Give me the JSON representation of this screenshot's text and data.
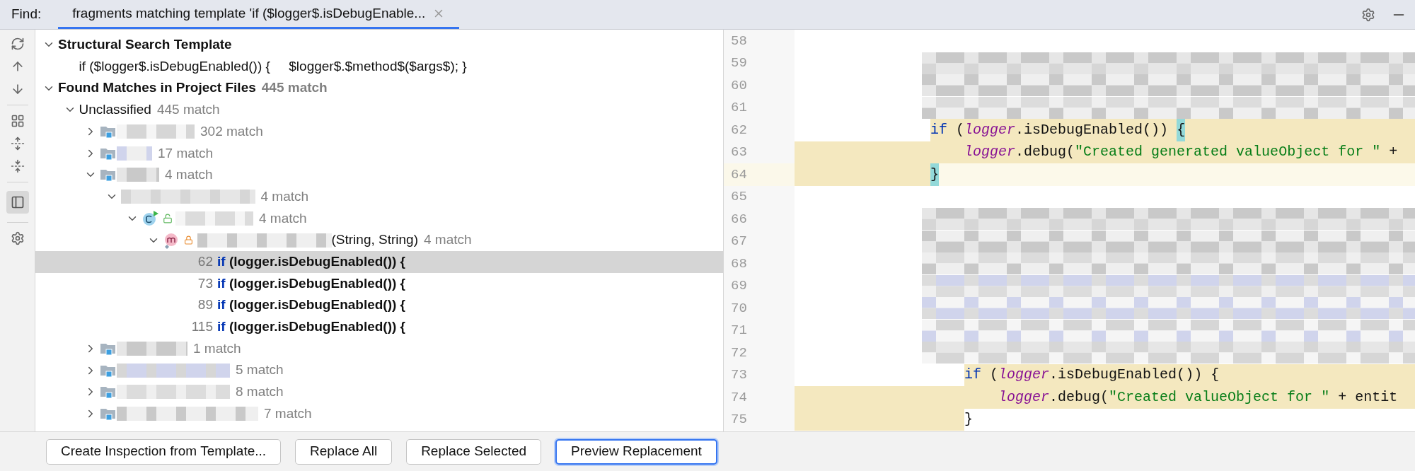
{
  "find_bar": {
    "label": "Find:",
    "tabs": [
      {
        "title": "fragments matching template 'if ($logger$.isDebugEnable...",
        "selected": true
      }
    ]
  },
  "toolbar": {
    "preview_on": true
  },
  "tree": [
    {
      "kind": "section",
      "label": "Structural Search Template",
      "expanded": true,
      "children": [
        {
          "kind": "template",
          "label": "if ($logger$.isDebugEnabled()) {     $logger$.$method$($args$); }"
        }
      ]
    },
    {
      "kind": "section",
      "label": "Found Matches in Project Files",
      "count": "445 match",
      "expanded": true,
      "children": [
        {
          "kind": "group",
          "label": "Unclassified",
          "count": "445 match",
          "expanded": true,
          "children": [
            {
              "kind": "folder",
              "count": "302 match",
              "expanded": false
            },
            {
              "kind": "folder",
              "count": "17 match",
              "expanded": false
            },
            {
              "kind": "folder",
              "count": "4 match",
              "expanded": true,
              "children": [
                {
                  "kind": "package",
                  "count": "4 match",
                  "expanded": true,
                  "children": [
                    {
                      "kind": "class",
                      "count": "4 match",
                      "expanded": true,
                      "children": [
                        {
                          "kind": "method",
                          "label": "(String, String)",
                          "count": "4 match",
                          "expanded": true,
                          "children": [
                            {
                              "kind": "match",
                              "line": "62",
                              "keyword": "if",
                              "code": "(logger.isDebugEnabled()) {",
                              "selected": true
                            },
                            {
                              "kind": "match",
                              "line": "73",
                              "keyword": "if",
                              "code": "(logger.isDebugEnabled()) {",
                              "selected": false
                            },
                            {
                              "kind": "match",
                              "line": "89",
                              "keyword": "if",
                              "code": "(logger.isDebugEnabled()) {",
                              "selected": false
                            },
                            {
                              "kind": "match",
                              "line": "115",
                              "keyword": "if",
                              "code": "(logger.isDebugEnabled()) {",
                              "selected": false
                            }
                          ]
                        }
                      ]
                    }
                  ]
                }
              ]
            },
            {
              "kind": "folder",
              "count": "1 match",
              "expanded": false
            },
            {
              "kind": "folder",
              "count": "5 match",
              "expanded": false
            },
            {
              "kind": "folder",
              "count": "8 match",
              "expanded": false
            },
            {
              "kind": "folder",
              "count": "7 match",
              "expanded": false
            }
          ]
        }
      ]
    }
  ],
  "editor": {
    "lines": [
      {
        "number": "58",
        "kind": "blank",
        "current": false
      },
      {
        "number": "59",
        "kind": "redacted",
        "current": false
      },
      {
        "number": "60",
        "kind": "redacted",
        "current": false
      },
      {
        "number": "61",
        "kind": "redacted",
        "current": false
      },
      {
        "number": "62",
        "kind": "code",
        "highlight_indent": false,
        "highlight_text": true,
        "current": false,
        "tokens": [
          {
            "kind": "keyword",
            "text": "                if"
          },
          {
            "kind": "plain",
            "text": " ("
          },
          {
            "kind": "field",
            "text": "logger"
          },
          {
            "kind": "plain",
            "text": ".isDebugEnabled()) "
          },
          {
            "kind": "brace",
            "text": "{"
          }
        ]
      },
      {
        "number": "63",
        "kind": "code",
        "highlight_indent": true,
        "highlight_text": true,
        "current": false,
        "tokens": [
          {
            "kind": "field",
            "text": "                    logger"
          },
          {
            "kind": "plain",
            "text": ".debug("
          },
          {
            "kind": "string",
            "text": "\"Created generated valueObject for \""
          },
          {
            "kind": "plain",
            "text": " +"
          }
        ]
      },
      {
        "number": "64",
        "kind": "code",
        "highlight_indent": true,
        "highlight_text": false,
        "current": true,
        "tokens": [
          {
            "kind": "brace",
            "text": "                }"
          }
        ]
      },
      {
        "number": "65",
        "kind": "blank",
        "current": false
      },
      {
        "number": "66",
        "kind": "redacted",
        "current": false
      },
      {
        "number": "67",
        "kind": "redacted",
        "current": false
      },
      {
        "number": "68",
        "kind": "redacted",
        "current": false
      },
      {
        "number": "69",
        "kind": "redacted",
        "current": false
      },
      {
        "number": "70",
        "kind": "redacted",
        "current": false
      },
      {
        "number": "71",
        "kind": "redacted",
        "current": false
      },
      {
        "number": "72",
        "kind": "redacted",
        "current": false
      },
      {
        "number": "73",
        "kind": "code",
        "highlight_indent": false,
        "highlight_text": true,
        "current": false,
        "tokens": [
          {
            "kind": "keyword",
            "text": "                    if"
          },
          {
            "kind": "plain",
            "text": " ("
          },
          {
            "kind": "field",
            "text": "logger"
          },
          {
            "kind": "plain",
            "text": ".isDebugEnabled()) {"
          }
        ]
      },
      {
        "number": "74",
        "kind": "code",
        "highlight_indent": true,
        "highlight_text": true,
        "current": false,
        "tokens": [
          {
            "kind": "field",
            "text": "                        logger"
          },
          {
            "kind": "plain",
            "text": ".debug("
          },
          {
            "kind": "string",
            "text": "\"Created valueObject for \""
          },
          {
            "kind": "plain",
            "text": " + entit"
          }
        ]
      },
      {
        "number": "75",
        "kind": "code",
        "highlight_indent": true,
        "highlight_text": false,
        "current": false,
        "tokens": [
          {
            "kind": "plain",
            "text": "                    }"
          }
        ]
      }
    ]
  },
  "buttons": [
    {
      "label": "Create Inspection from Template...",
      "focused": false
    },
    {
      "label": "Replace All",
      "focused": false
    },
    {
      "label": "Replace Selected",
      "focused": false
    },
    {
      "label": "Preview Replacement",
      "focused": true
    }
  ]
}
